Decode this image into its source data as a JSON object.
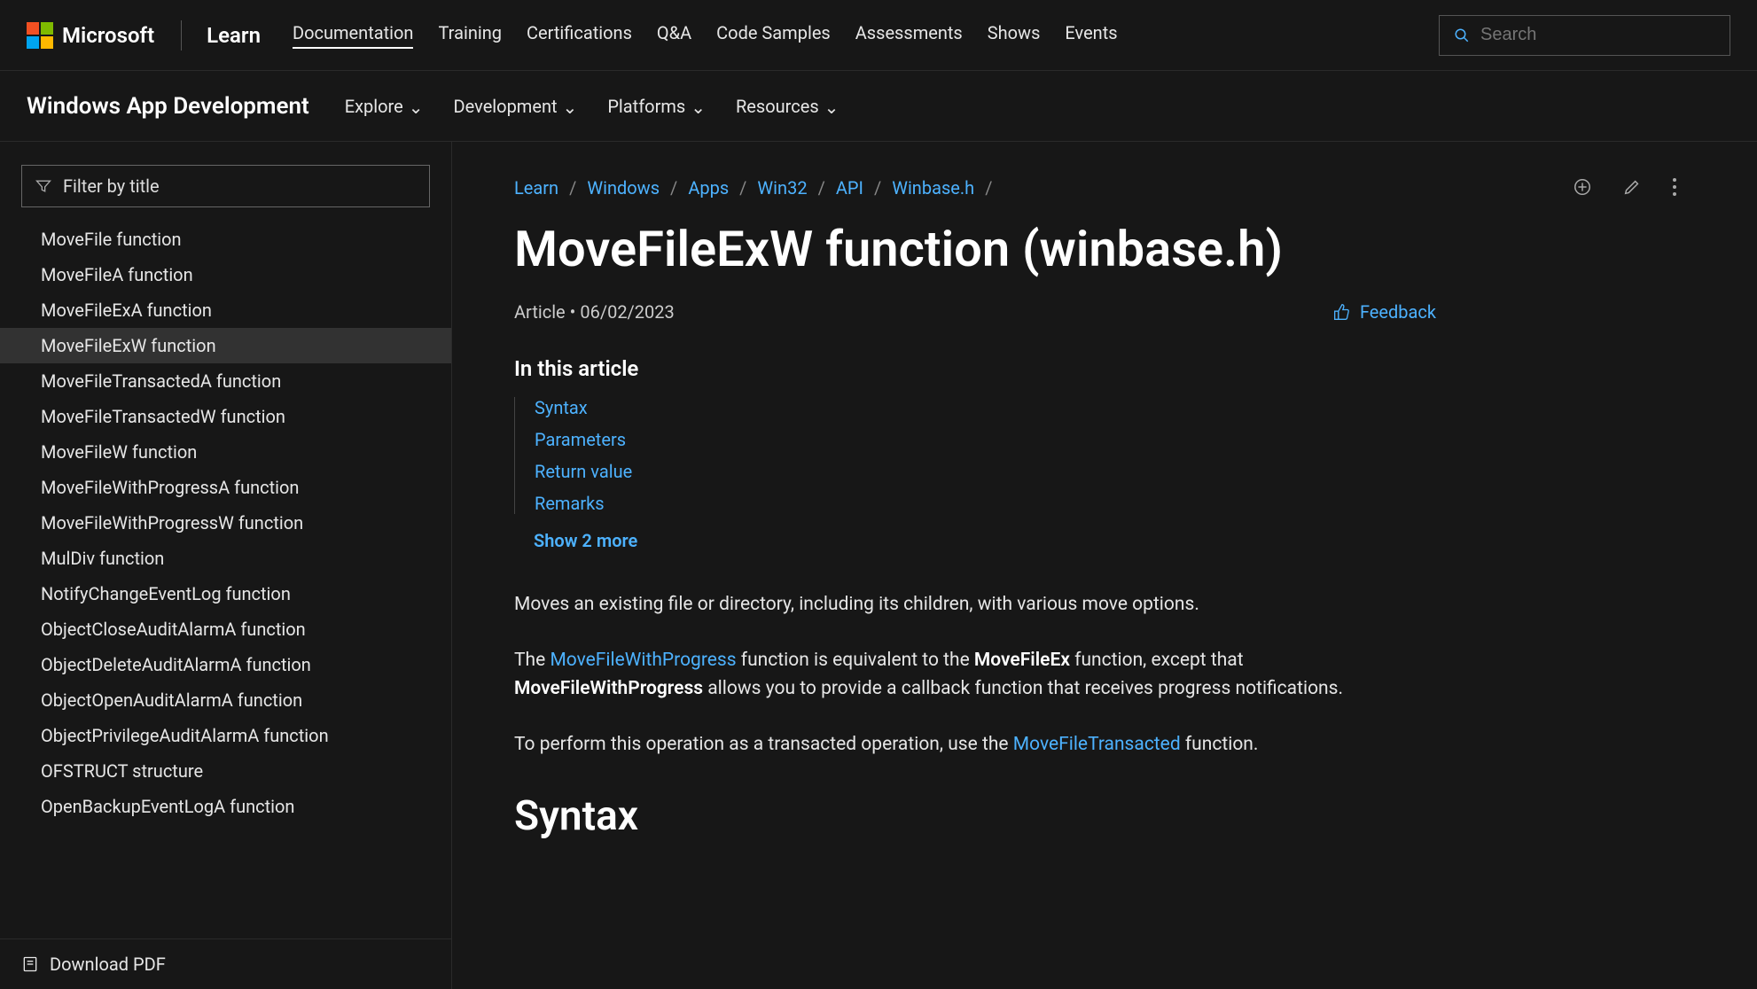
{
  "header": {
    "logo_text": "Microsoft",
    "brand": "Learn",
    "nav": [
      {
        "label": "Documentation",
        "active": true
      },
      {
        "label": "Training"
      },
      {
        "label": "Certifications"
      },
      {
        "label": "Q&A"
      },
      {
        "label": "Code Samples"
      },
      {
        "label": "Assessments"
      },
      {
        "label": "Shows"
      },
      {
        "label": "Events"
      }
    ],
    "search_placeholder": "Search"
  },
  "subheader": {
    "title": "Windows App Development",
    "items": [
      "Explore",
      "Development",
      "Platforms",
      "Resources"
    ]
  },
  "sidebar": {
    "filter_placeholder": "Filter by title",
    "items": [
      {
        "label": "MoveFile function"
      },
      {
        "label": "MoveFileA function"
      },
      {
        "label": "MoveFileExA function"
      },
      {
        "label": "MoveFileExW function",
        "selected": true
      },
      {
        "label": "MoveFileTransactedA function"
      },
      {
        "label": "MoveFileTransactedW function"
      },
      {
        "label": "MoveFileW function"
      },
      {
        "label": "MoveFileWithProgressA function"
      },
      {
        "label": "MoveFileWithProgressW function"
      },
      {
        "label": "MulDiv function"
      },
      {
        "label": "NotifyChangeEventLog function"
      },
      {
        "label": "ObjectCloseAuditAlarmA function"
      },
      {
        "label": "ObjectDeleteAuditAlarmA function"
      },
      {
        "label": "ObjectOpenAuditAlarmA function"
      },
      {
        "label": "ObjectPrivilegeAuditAlarmA function"
      },
      {
        "label": "OFSTRUCT structure"
      },
      {
        "label": "OpenBackupEventLogA function"
      }
    ],
    "download_pdf": "Download PDF"
  },
  "breadcrumbs": [
    "Learn",
    "Windows",
    "Apps",
    "Win32",
    "API",
    "Winbase.h"
  ],
  "page": {
    "title": "MoveFileExW function (winbase.h)",
    "type": "Article",
    "date": "06/02/2023",
    "feedback_label": "Feedback",
    "in_this_article_heading": "In this article",
    "in_this_article": [
      "Syntax",
      "Parameters",
      "Return value",
      "Remarks"
    ],
    "show_more": "Show 2 more",
    "p1": "Moves an existing file or directory, including its children, with various move options.",
    "p2_pre": "The ",
    "p2_link1": "MoveFileWithProgress",
    "p2_mid1": " function is equivalent to the ",
    "p2_strong1": "MoveFileEx",
    "p2_mid2": " function, except that ",
    "p2_strong2": "MoveFileWithProgress",
    "p2_post": " allows you to provide a callback function that receives progress notifications.",
    "p3_pre": "To perform this operation as a transacted operation, use the ",
    "p3_link": "MoveFileTransacted",
    "p3_post": " function.",
    "section_syntax": "Syntax"
  }
}
